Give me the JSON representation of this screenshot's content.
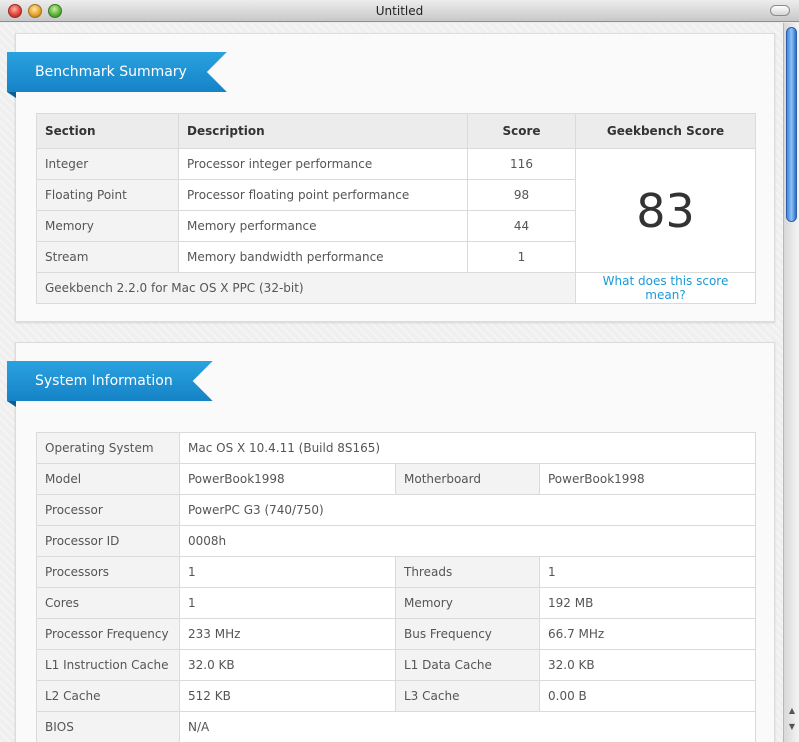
{
  "window": {
    "title": "Untitled"
  },
  "summary": {
    "ribbon": "Benchmark Summary",
    "headers": {
      "section": "Section",
      "description": "Description",
      "score": "Score",
      "geekbench": "Geekbench Score"
    },
    "rows": [
      {
        "section": "Integer",
        "description": "Processor integer performance",
        "score": "116"
      },
      {
        "section": "Floating Point",
        "description": "Processor floating point performance",
        "score": "98"
      },
      {
        "section": "Memory",
        "description": "Memory performance",
        "score": "44"
      },
      {
        "section": "Stream",
        "description": "Memory bandwidth performance",
        "score": "1"
      }
    ],
    "geekbench_score": "83",
    "footer": "Geekbench 2.2.0 for Mac OS X PPC (32-bit)",
    "link": "What does this score mean?"
  },
  "sysinfo": {
    "ribbon": "System Information",
    "os": {
      "label": "Operating System",
      "value": "Mac OS X 10.4.11 (Build 8S165)"
    },
    "model": {
      "label": "Model",
      "value": "PowerBook1998"
    },
    "motherboard": {
      "label": "Motherboard",
      "value": "PowerBook1998"
    },
    "processor": {
      "label": "Processor",
      "value": "PowerPC G3 (740/750)"
    },
    "processor_id": {
      "label": "Processor ID",
      "value": "0008h"
    },
    "processors": {
      "label": "Processors",
      "value": "1"
    },
    "threads": {
      "label": "Threads",
      "value": "1"
    },
    "cores": {
      "label": "Cores",
      "value": "1"
    },
    "memory": {
      "label": "Memory",
      "value": "192 MB"
    },
    "proc_freq": {
      "label": "Processor Frequency",
      "value": "233 MHz"
    },
    "bus_freq": {
      "label": "Bus Frequency",
      "value": "66.7 MHz"
    },
    "l1i": {
      "label": "L1 Instruction Cache",
      "value": "32.0 KB"
    },
    "l1d": {
      "label": "L1 Data Cache",
      "value": "32.0 KB"
    },
    "l2": {
      "label": "L2 Cache",
      "value": "512 KB"
    },
    "l3": {
      "label": "L3 Cache",
      "value": "0.00 B"
    },
    "bios": {
      "label": "BIOS",
      "value": "N/A"
    }
  }
}
